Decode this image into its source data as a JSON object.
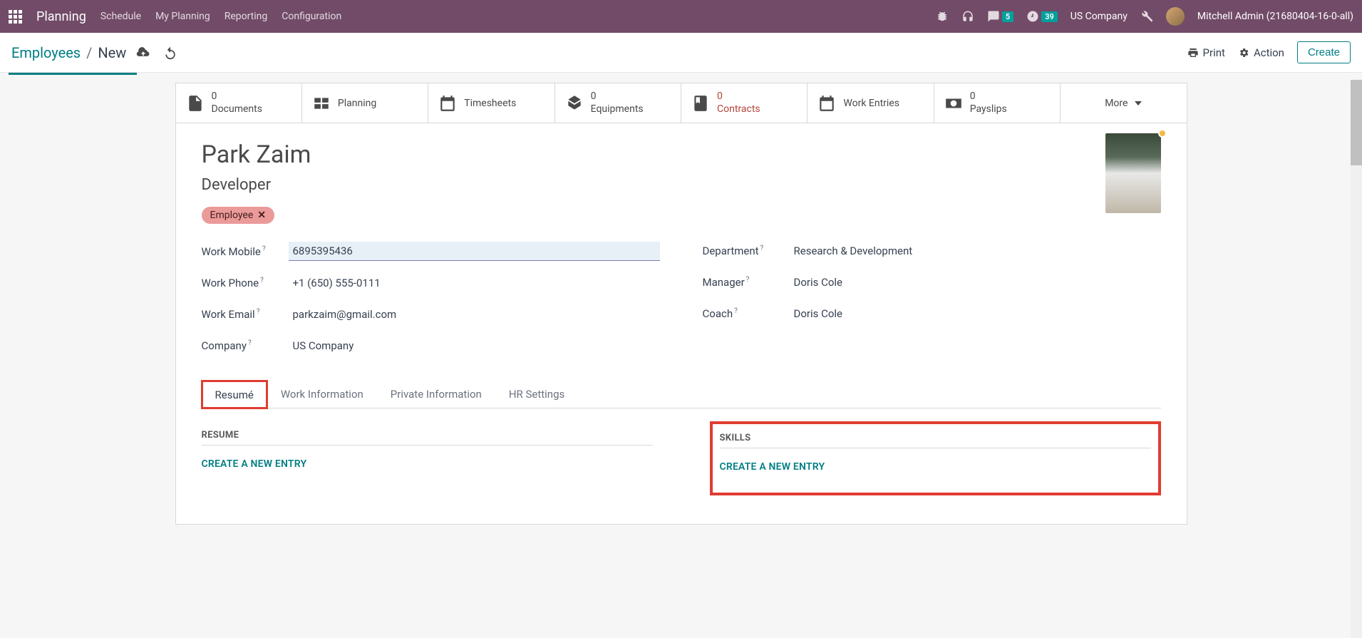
{
  "topbar": {
    "app": "Planning",
    "menus": [
      "Schedule",
      "My Planning",
      "Reporting",
      "Configuration"
    ],
    "msg_count": "5",
    "clock_count": "39",
    "company": "US Company",
    "user": "Mitchell Admin (21680404-16-0-all)"
  },
  "breadcrumb": {
    "root": "Employees",
    "current": "New",
    "print": "Print",
    "action": "Action",
    "create": "Create"
  },
  "stats": {
    "documents_n": "0",
    "documents": "Documents",
    "planning": "Planning",
    "timesheets": "Timesheets",
    "equip_n": "0",
    "equip": "Equipments",
    "contracts_n": "0",
    "contracts": "Contracts",
    "workentries": "Work Entries",
    "payslips_n": "0",
    "payslips": "Payslips",
    "more": "More"
  },
  "employee": {
    "name": "Park Zaim",
    "title": "Developer",
    "tag": "Employee"
  },
  "fields": {
    "work_mobile_l": "Work Mobile",
    "work_mobile_v": "6895395436",
    "work_phone_l": "Work Phone",
    "work_phone_v": "+1 (650) 555-0111",
    "work_email_l": "Work Email",
    "work_email_v": "parkzaim@gmail.com",
    "company_l": "Company",
    "company_v": "US Company",
    "department_l": "Department",
    "department_v": "Research & Development",
    "manager_l": "Manager",
    "manager_v": "Doris Cole",
    "coach_l": "Coach",
    "coach_v": "Doris Cole"
  },
  "tabs": [
    "Resumé",
    "Work Information",
    "Private Information",
    "HR Settings"
  ],
  "resume": {
    "resume_h": "RESUME",
    "skills_h": "SKILLS",
    "create_entry": "CREATE A NEW ENTRY"
  }
}
